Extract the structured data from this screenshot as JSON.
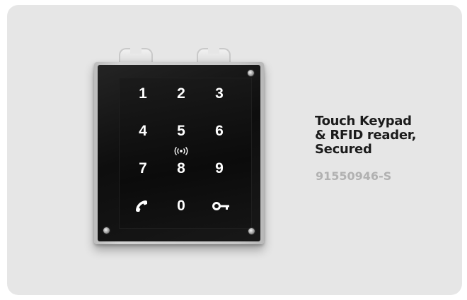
{
  "product": {
    "title_lines": [
      "Touch Keypad",
      "& RFID reader,",
      "Secured"
    ],
    "code": "91550946-S"
  },
  "keypad": {
    "keys": [
      "1",
      "2",
      "3",
      "4",
      "5",
      "6",
      "7",
      "8",
      "9",
      "0"
    ],
    "icons": [
      "phone-icon",
      "rfid-icon",
      "key-icon"
    ]
  },
  "colors": {
    "background": "#e6e6e6",
    "title": "#1b1b1b",
    "code": "#b1b1b1",
    "panel": "#0e0e0e"
  }
}
